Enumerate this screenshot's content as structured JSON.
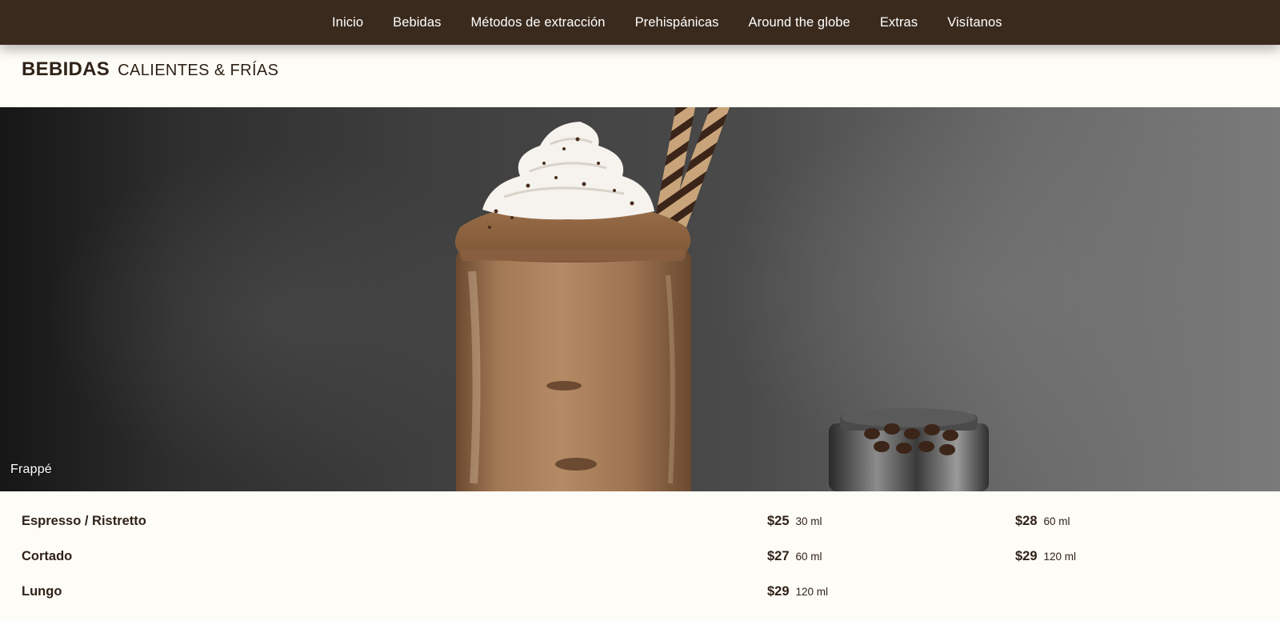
{
  "nav": {
    "items": [
      "Inicio",
      "Bebidas",
      "Métodos de extracción",
      "Prehispánicas",
      "Around the globe",
      "Extras",
      "Visítanos"
    ]
  },
  "heading": {
    "main": "BEBIDAS",
    "sub": "CALIENTES & FRÍAS"
  },
  "hero": {
    "caption": "Frappé"
  },
  "menu": [
    {
      "name": "Espresso / Ristretto",
      "prices": [
        {
          "price": "$25",
          "size": "30 ml"
        },
        {
          "price": "$28",
          "size": "60 ml"
        }
      ]
    },
    {
      "name": "Cortado",
      "prices": [
        {
          "price": "$27",
          "size": "60 ml"
        },
        {
          "price": "$29",
          "size": "120 ml"
        }
      ]
    },
    {
      "name": "Lungo",
      "prices": [
        {
          "price": "$29",
          "size": "120 ml"
        }
      ]
    }
  ],
  "colors": {
    "nav_bg": "#3a2a1d",
    "page_bg": "#fefcf6",
    "text": "#2f2218"
  }
}
